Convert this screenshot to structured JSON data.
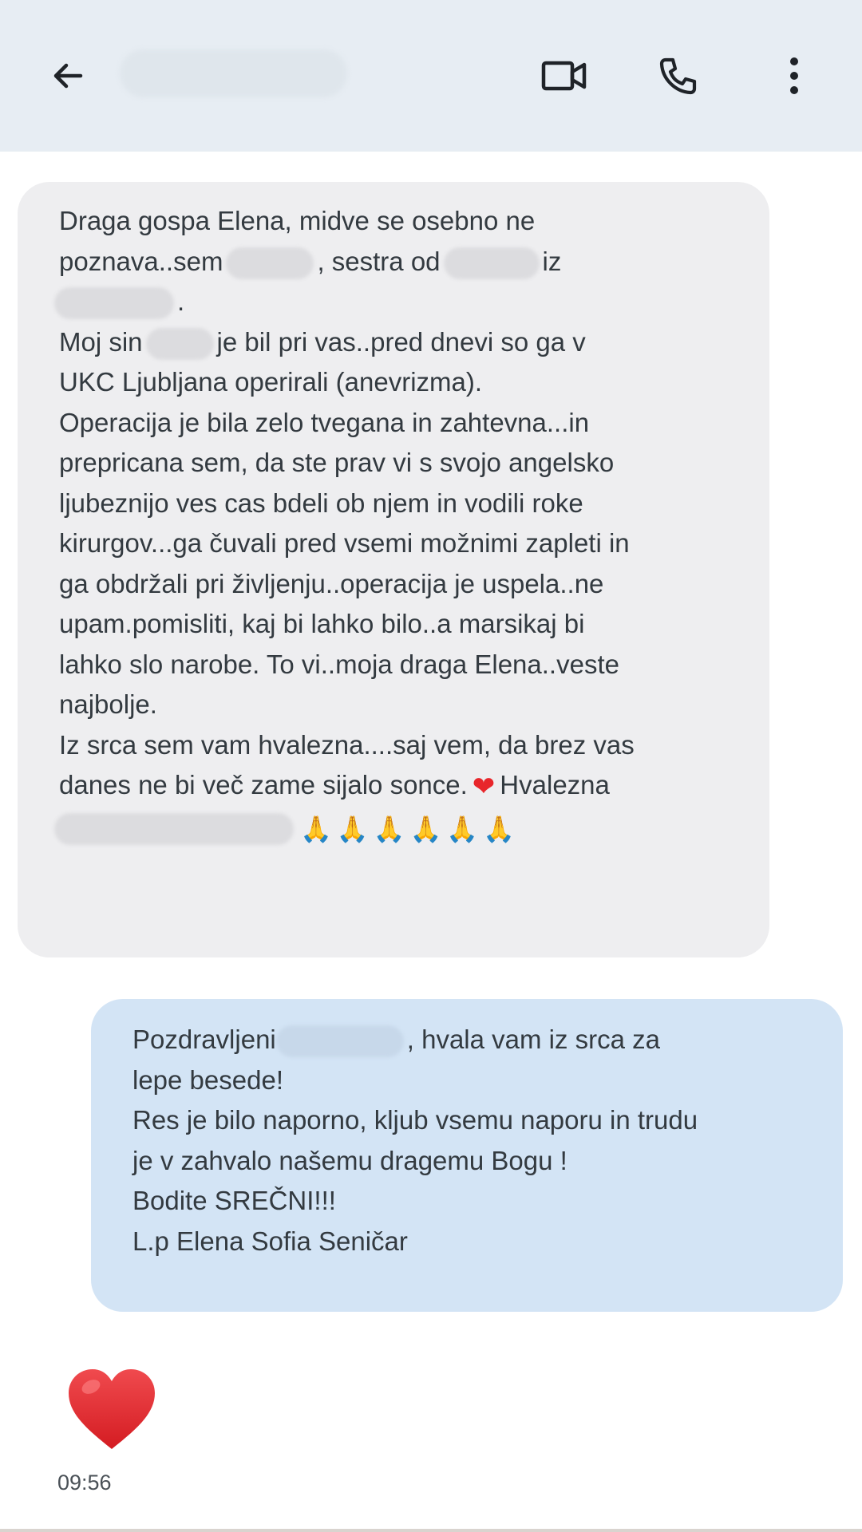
{
  "header": {
    "contact_name": "",
    "back_icon": "arrow-left-icon",
    "video_icon": "video-call-icon",
    "call_icon": "phone-icon",
    "more_icon": "more-vertical-icon"
  },
  "messages": {
    "incoming": {
      "line1": "Draga gospa Elena, midve se osebno ne",
      "line2_a": "poznava..sem",
      "line2_b": ", sestra od",
      "line2_c": "iz",
      "line3_a": ".",
      "line4_a": "Moj sin",
      "line4_b": "je bil pri vas..pred dnevi so ga v",
      "line5": "UKC Ljubljana operirali (anevrizma).",
      "line6": "Operacija je bila zelo tvegana in zahtevna...in",
      "line7": "prepricana sem, da ste prav vi s svojo angelsko",
      "line8": "ljubeznijo ves cas bdeli ob njem in vodili roke",
      "line9": "kirurgov...ga čuvali pred vsemi možnimi zapleti in",
      "line10": "ga obdržali pri življenju..operacija je uspela..ne",
      "line11": "upam.pomisliti, kaj bi lahko bilo..a marsikaj bi",
      "line12": "lahko slo narobe. To vi..moja draga Elena..veste",
      "line13": "najbolje.",
      "line14": "Iz srca sem vam hvalezna....saj vem, da brez vas",
      "line15_a": "danes ne bi več zame sijalo sonce.",
      "line15_heart": "❤",
      "line15_b": "Hvalezna",
      "line16_pray": "🙏🙏🙏🙏🙏🙏"
    },
    "outgoing": {
      "line1_a": "Pozdravljeni",
      "line1_b": ",  hvala vam iz srca za",
      "line2": "lepe besede!",
      "line3": "Res je bilo naporno, kljub vsemu naporu in trudu",
      "line4": "je v zahvalo našemu dragemu Bogu !",
      "line5": "Bodite SREČNI!!!",
      "line6": "L.p Elena Sofia Seničar"
    },
    "reaction": {
      "icon": "heart-icon",
      "time": "09:56"
    }
  },
  "colors": {
    "header_bg": "#e7edf3",
    "incoming_bg": "#eeeef0",
    "outgoing_bg": "#d3e4f5",
    "heart": "#e8262b"
  }
}
